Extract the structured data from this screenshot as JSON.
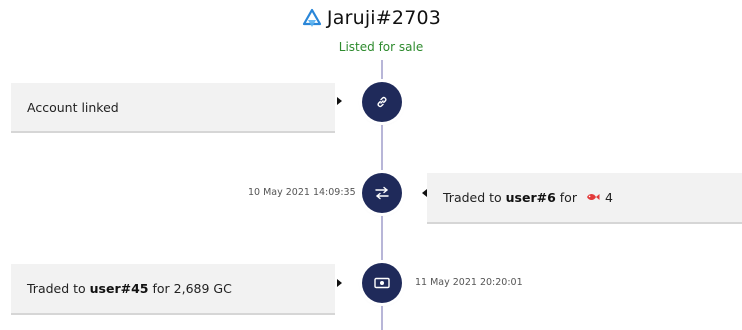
{
  "header": {
    "title": "Jaruji#2703",
    "status": "Listed for sale",
    "logo_icon": "blue-bolt-logo-icon"
  },
  "colors": {
    "node_bg": "#1f2a5a",
    "status_green": "#2e8b2e",
    "timeline_line": "#b8b6d8",
    "card_bg": "#f2f2f2"
  },
  "events": [
    {
      "icon": "link-icon",
      "text": "Account linked",
      "timestamp": ""
    },
    {
      "icon": "swap-arrows-icon",
      "text_prefix": "Traded to ",
      "user": "user#6",
      "text_mid": " for ",
      "price_icon": "red-fish-icon",
      "price": "4",
      "timestamp": "10 May 2021 14:09:35"
    },
    {
      "icon": "cash-icon",
      "text_prefix": "Traded to ",
      "user": "user#45",
      "text_suffix": " for 2,689 GC",
      "timestamp": "11 May 2021 20:20:01"
    }
  ]
}
